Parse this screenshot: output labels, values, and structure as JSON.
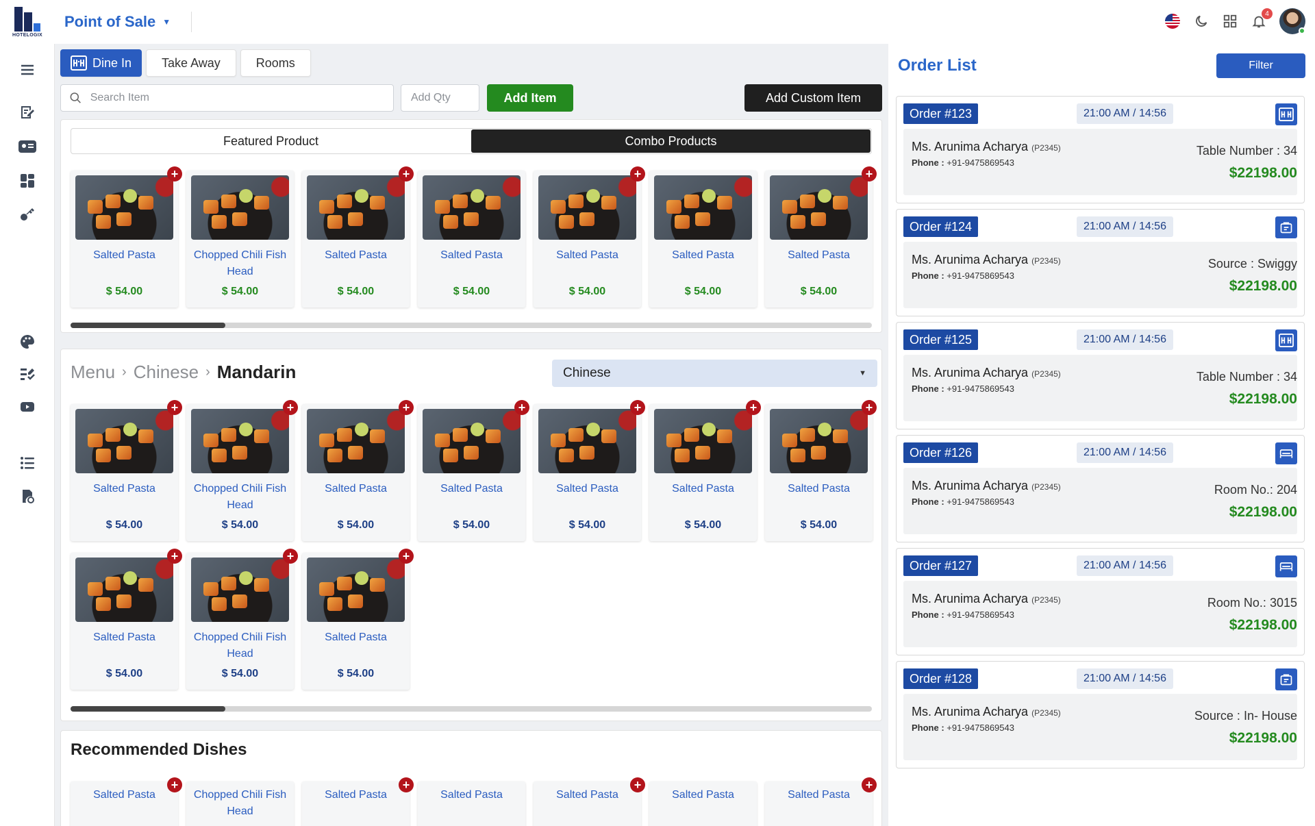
{
  "app": {
    "logo_text": "HOTELOGIX",
    "title": "Point of Sale",
    "notifications_count": "4"
  },
  "order_modes": [
    "Dine In",
    "Take Away",
    "Rooms"
  ],
  "search": {
    "placeholder": "Search Item",
    "qty_placeholder": "Add Qty",
    "add_button": "Add Item",
    "custom_button": "Add Custom Item"
  },
  "featured": {
    "tabs": [
      "Featured Product",
      "Combo Products"
    ],
    "active_tab": "Combo Products",
    "items": [
      {
        "name": "Salted Pasta",
        "price": "$ 54.00"
      },
      {
        "name": "Chopped Chili Fish Head",
        "price": "$ 54.00"
      },
      {
        "name": "Salted Pasta",
        "price": "$ 54.00"
      },
      {
        "name": "Salted Pasta",
        "price": "$ 54.00"
      },
      {
        "name": "Salted Pasta",
        "price": "$ 54.00"
      },
      {
        "name": "Salted Pasta",
        "price": "$ 54.00"
      },
      {
        "name": "Salted Pasta",
        "price": "$ 54.00"
      }
    ]
  },
  "menu": {
    "breadcrumb": [
      "Menu",
      "Chinese",
      "Mandarin"
    ],
    "cuisine_selected": "Chinese",
    "items": [
      {
        "name": "Salted Pasta",
        "price": "$ 54.00"
      },
      {
        "name": "Chopped Chili Fish Head",
        "price": "$ 54.00"
      },
      {
        "name": "Salted Pasta",
        "price": "$ 54.00"
      },
      {
        "name": "Salted Pasta",
        "price": "$ 54.00"
      },
      {
        "name": "Salted Pasta",
        "price": "$ 54.00"
      },
      {
        "name": "Salted Pasta",
        "price": "$ 54.00"
      },
      {
        "name": "Salted Pasta",
        "price": "$ 54.00"
      },
      {
        "name": "Salted Pasta",
        "price": "$ 54.00"
      },
      {
        "name": "Chopped Chili Fish Head",
        "price": "$ 54.00"
      },
      {
        "name": "Salted Pasta",
        "price": "$ 54.00"
      }
    ]
  },
  "recommended": {
    "title": "Recommended Dishes",
    "items": [
      {
        "name": "Salted Pasta"
      },
      {
        "name": "Chopped Chili Fish Head"
      },
      {
        "name": "Salted Pasta"
      },
      {
        "name": "Salted Pasta"
      },
      {
        "name": "Salted Pasta"
      },
      {
        "name": "Salted Pasta"
      },
      {
        "name": "Salted Pasta"
      }
    ]
  },
  "orders": {
    "title": "Order List",
    "filter_label": "Filter",
    "list": [
      {
        "id": "Order #123",
        "time": "21:00 AM  /  14:56",
        "type": "dine-in",
        "guest": "Ms. Arunima Acharya",
        "code": "(P2345)",
        "phone_label": "Phone :",
        "phone": "+91-9475869543",
        "meta_label": "Table Number :",
        "meta_value": "34",
        "total": "$22198.00"
      },
      {
        "id": "Order #124",
        "time": "21:00 AM  /  14:56",
        "type": "takeaway",
        "guest": "Ms. Arunima Acharya",
        "code": "(P2345)",
        "phone_label": "Phone :",
        "phone": "+91-9475869543",
        "meta_label": "Source :",
        "meta_value": "Swiggy",
        "total": "$22198.00"
      },
      {
        "id": "Order #125",
        "time": "21:00 AM  /  14:56",
        "type": "dine-in",
        "guest": "Ms. Arunima Acharya",
        "code": "(P2345)",
        "phone_label": "Phone :",
        "phone": "+91-9475869543",
        "meta_label": "Table Number :",
        "meta_value": "34",
        "total": "$22198.00"
      },
      {
        "id": "Order #126",
        "time": "21:00 AM  /  14:56",
        "type": "room",
        "guest": "Ms. Arunima Acharya",
        "code": "(P2345)",
        "phone_label": "Phone :",
        "phone": "+91-9475869543",
        "meta_label": "Room No.:",
        "meta_value": "204",
        "total": "$22198.00"
      },
      {
        "id": "Order #127",
        "time": "21:00 AM  /  14:56",
        "type": "room",
        "guest": "Ms. Arunima Acharya",
        "code": "(P2345)",
        "phone_label": "Phone :",
        "phone": "+91-9475869543",
        "meta_label": "Room No.:",
        "meta_value": "3015",
        "total": "$22198.00"
      },
      {
        "id": "Order #128",
        "time": "21:00 AM  /  14:56",
        "type": "takeaway",
        "guest": "Ms. Arunima Acharya",
        "code": "(P2345)",
        "phone_label": "Phone :",
        "phone": "+91-9475869543",
        "meta_label": "Source :",
        "meta_value": "In- House",
        "total": "$22198.00"
      }
    ]
  },
  "colors": {
    "brand": "#2a66c9",
    "primary": "#2a5cbf",
    "success": "#248a1f",
    "danger": "#b3141b"
  },
  "icons": {
    "sidebar": [
      "menu-icon",
      "edit-note-icon",
      "id-card-icon",
      "dashboard-icon",
      "key-icon",
      "palette-icon",
      "tasks-icon",
      "video-icon",
      "list-icon",
      "settings-gear-icon"
    ],
    "topbar": [
      "us-flag-icon",
      "dark-mode-icon",
      "apps-grid-icon",
      "bell-icon",
      "avatar"
    ]
  }
}
